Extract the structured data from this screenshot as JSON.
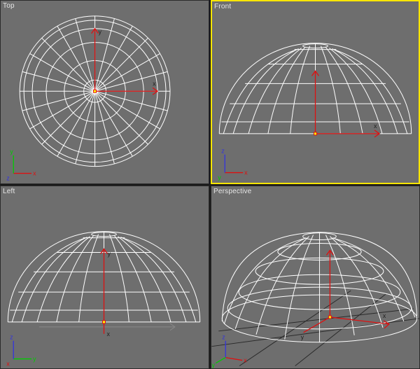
{
  "viewport": {
    "top": {
      "label": "Top",
      "gizmo": {
        "right": "x",
        "up": "y",
        "out": "z"
      }
    },
    "front": {
      "label": "Front",
      "gizmo": {
        "right": "x",
        "up": "z",
        "out": "y"
      }
    },
    "left": {
      "label": "Left",
      "gizmo": {
        "right": "y",
        "up": "z",
        "out": "x"
      }
    },
    "persp": {
      "label": "Perspective",
      "gizmo": {
        "right": "x",
        "up": "z",
        "out": "y"
      }
    }
  },
  "active_viewport": "front",
  "geometry": {
    "type": "hemisphere",
    "rendering": "wireframe",
    "segments": 24,
    "rings": 6,
    "color": "#ffffff"
  },
  "helper_axis": {
    "x_label": "x",
    "y_label": "y",
    "color_x": "#d11",
    "color_y": "#d11"
  }
}
